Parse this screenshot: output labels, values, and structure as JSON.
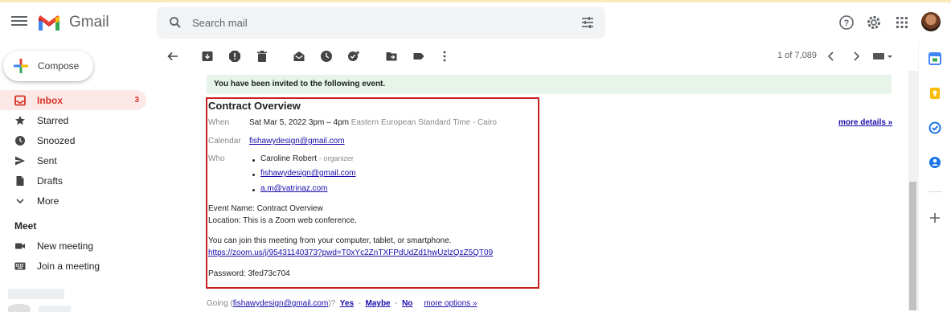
{
  "header": {
    "logo_text": "Gmail",
    "search_placeholder": "Search mail"
  },
  "compose": {
    "label": "Compose"
  },
  "nav": {
    "items": [
      {
        "label": "Inbox",
        "count": "3",
        "icon": "inbox-icon"
      },
      {
        "label": "Starred",
        "icon": "star-icon"
      },
      {
        "label": "Snoozed",
        "icon": "clock-icon"
      },
      {
        "label": "Sent",
        "icon": "send-icon"
      },
      {
        "label": "Drafts",
        "icon": "file-icon"
      },
      {
        "label": "More",
        "icon": "chevron-down-icon"
      }
    ],
    "meet_title": "Meet",
    "meet_items": [
      {
        "label": "New meeting",
        "icon": "videocam-icon"
      },
      {
        "label": "Join a meeting",
        "icon": "keyboard-icon"
      }
    ]
  },
  "toolbar": {
    "pager": "1 of 7,089"
  },
  "message": {
    "banner": "You have been invited to the following event.",
    "title": "Contract Overview",
    "when_label": "When",
    "when_value": "Sat Mar 5, 2022 3pm – 4pm",
    "when_tz": "Eastern European Standard Time - Cairo",
    "more_details": "more details »",
    "calendar_label": "Calendar",
    "calendar_value": "fishawydesign@gmail.com",
    "who_label": "Who",
    "who": [
      {
        "name": "Caroline Robert",
        "role": "- organizer"
      },
      {
        "name": "fishawydesign@gmail.com",
        "role": ""
      },
      {
        "name": "a.m@vatrinaz.com",
        "role": ""
      }
    ],
    "event_name": "Event Name: Contract Overview",
    "location": "Location: This is a Zoom web conference.",
    "join_text": "You can join this meeting from your computer, tablet, or smartphone.",
    "zoom_link": "https://zoom.us/j/95431140373?pwd=T0xYc2ZnTXFPdUdZd1hwUzlzQzZ5QT09",
    "password": "Password: 3fed73c704",
    "going_prefix": "Going (",
    "going_email": "fishawydesign@gmail.com",
    "going_suffix": ")?",
    "yes": "Yes",
    "maybe": "Maybe",
    "no": "No",
    "more_options": "more options »"
  },
  "colors": {
    "accent_red": "#d93025",
    "banner_green": "#e6f4ea",
    "highlight_border": "#c5221f",
    "link_blue": "#1a0dab"
  }
}
